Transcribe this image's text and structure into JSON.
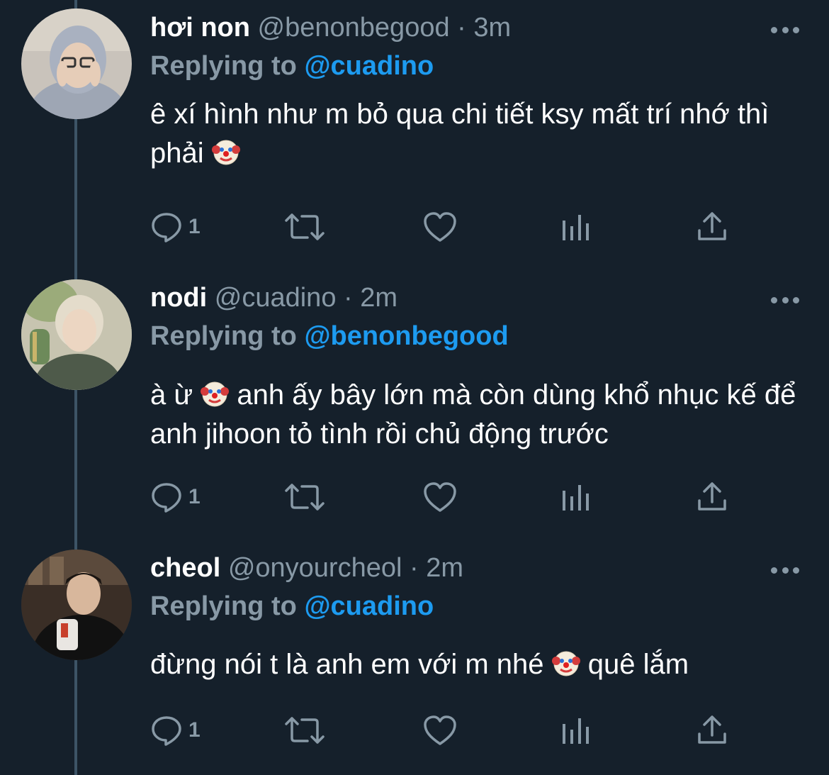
{
  "colors": {
    "background": "#15202b",
    "secondary_text": "#8899a6",
    "link": "#1d9bf0",
    "thread_line": "#3d5466"
  },
  "tweets": [
    {
      "display_name": "hơi non",
      "handle": "@benonbegood",
      "separator": "·",
      "time": "3m",
      "replying_prefix": "Replying to",
      "replying_to": "@cuadino",
      "text_parts": [
        "ê xí hình như m bỏ qua chi tiết ksy mất trí nhớ thì phải",
        ""
      ],
      "emoji": "clown-face",
      "reply_count": "1"
    },
    {
      "display_name": "nodi",
      "handle": "@cuadino",
      "separator": "·",
      "time": "2m",
      "replying_prefix": "Replying to",
      "replying_to": "@benonbegood",
      "text_parts": [
        "à ừ",
        "anh ấy bây lớn mà còn dùng khổ nhục kế để anh jihoon tỏ tình rồi chủ động trước"
      ],
      "emoji": "clown-face",
      "reply_count": "1"
    },
    {
      "display_name": "cheol",
      "handle": "@onyourcheol",
      "separator": "·",
      "time": "2m",
      "replying_prefix": "Replying to",
      "replying_to": "@cuadino",
      "text_parts": [
        "đừng nói t là anh em với m nhé",
        "quê lắm"
      ],
      "emoji": "clown-face",
      "reply_count": "1"
    }
  ],
  "icons": {
    "reply": "speech-bubble-icon",
    "retweet": "retweet-arrows-icon",
    "like": "heart-outline-icon",
    "analytics": "bar-chart-icon",
    "share": "share-upload-icon",
    "more": "more-dots-icon"
  }
}
